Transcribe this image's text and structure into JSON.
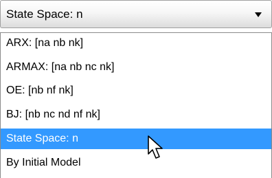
{
  "combo": {
    "value": "State Space: n",
    "arrow_icon": "chevron-down-icon"
  },
  "list": {
    "items": [
      {
        "label": "ARX: [na nb nk]"
      },
      {
        "label": "ARMAX: [na nb nc nk]"
      },
      {
        "label": "OE: [nb nf nk]"
      },
      {
        "label": "BJ: [nb nc nd nf nk]"
      },
      {
        "label": "State Space: n"
      },
      {
        "label": "By Initial Model"
      }
    ],
    "selected_index": 4
  },
  "colors": {
    "selection": "#3399ff",
    "selection_text": "#ffffff"
  },
  "cursor_icon": "mouse-pointer-icon"
}
